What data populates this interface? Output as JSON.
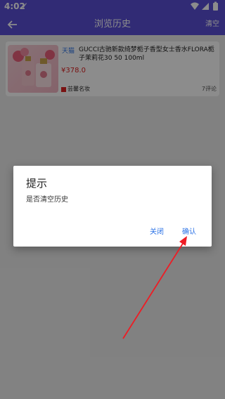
{
  "status_bar": {
    "time": "4:02",
    "check_icon": "check-icon",
    "wifi_icon": "wifi-icon",
    "signal_icon": "signal-icon",
    "battery_icon": "battery-icon"
  },
  "app_bar": {
    "title": "浏览历史",
    "clear_label": "清空",
    "back_icon": "back-arrow-icon",
    "color": "#5a4fd6"
  },
  "history": {
    "items": [
      {
        "shop_tag": "天猫",
        "title": "GUCCI古驰新款绮梦栀子香型女士香水FLORA栀子茉莉花30 50 100ml",
        "price": "¥378.0",
        "store": "芸馨名妆",
        "reviews": "7评论"
      }
    ]
  },
  "dialog": {
    "title": "提示",
    "message": "是否清空历史",
    "cancel_label": "关闭",
    "confirm_label": "确认",
    "accent": "#2b72e6"
  },
  "annotation": {
    "color": "#ee1c24"
  }
}
